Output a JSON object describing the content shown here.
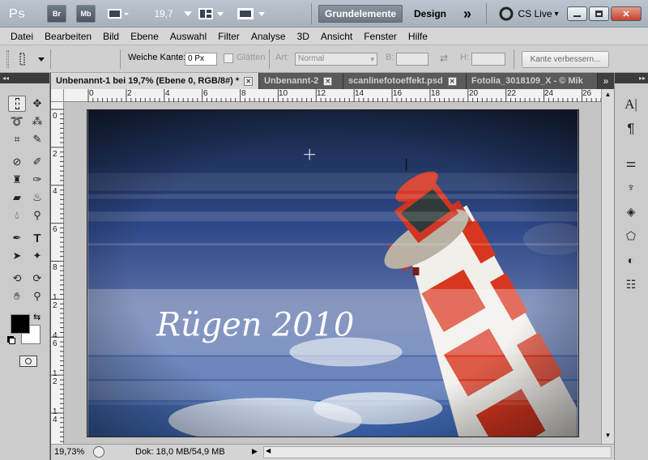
{
  "appbar": {
    "logo": "Ps",
    "bridge_label": "Br",
    "minibridge_label": "Mb",
    "zoom_value": "19,7",
    "workspace_active": "Grundelemente",
    "workspace_other": "Design",
    "more_label": "»",
    "cslive_label": "CS Live",
    "cslive_arrow": "▾"
  },
  "menubar": {
    "items": [
      "Datei",
      "Bearbeiten",
      "Bild",
      "Ebene",
      "Auswahl",
      "Filter",
      "Analyse",
      "3D",
      "Ansicht",
      "Fenster",
      "Hilfe"
    ]
  },
  "options": {
    "feather_label": "Weiche Kante:",
    "feather_value": "0 Px",
    "antialias_label": "Glätten",
    "style_label": "Art:",
    "style_value": "Normal",
    "width_label": "B:",
    "height_label": "H:",
    "refine_edge_label": "Kante verbessern..."
  },
  "tabs": [
    {
      "label": "Unbenannt-1 bei 19,7% (Ebene 0, RGB/8#) *",
      "close": "✕"
    },
    {
      "label": "Unbenannt-2",
      "close": "✕"
    },
    {
      "label": "scanlinefotoeffekt.psd",
      "close": "✕"
    },
    {
      "label": "Fotolia_3018109_X - © Mik",
      "close": ""
    }
  ],
  "tabs_more": "»",
  "ruler": {
    "h_labels": [
      "0",
      "2",
      "4",
      "6",
      "8",
      "10",
      "12",
      "14",
      "16",
      "18",
      "20",
      "22",
      "24",
      "26"
    ],
    "v_labels": [
      "0",
      "2",
      "4",
      "6",
      "8",
      "1",
      "2",
      "4",
      "6",
      "1",
      "0",
      "1",
      "2",
      "1",
      "4",
      "1",
      "6"
    ]
  },
  "canvas": {
    "caption": "Rügen 2010"
  },
  "status": {
    "zoom": "19,73%",
    "doc_info": "Dok: 18,0 MB/54,9 MB"
  },
  "colors": {
    "foreground": "#000000",
    "background": "#ffffff",
    "sky_top": "#1c2a4a",
    "sky_mid": "#3c5aa0",
    "lighthouse_red": "#d8361f"
  }
}
